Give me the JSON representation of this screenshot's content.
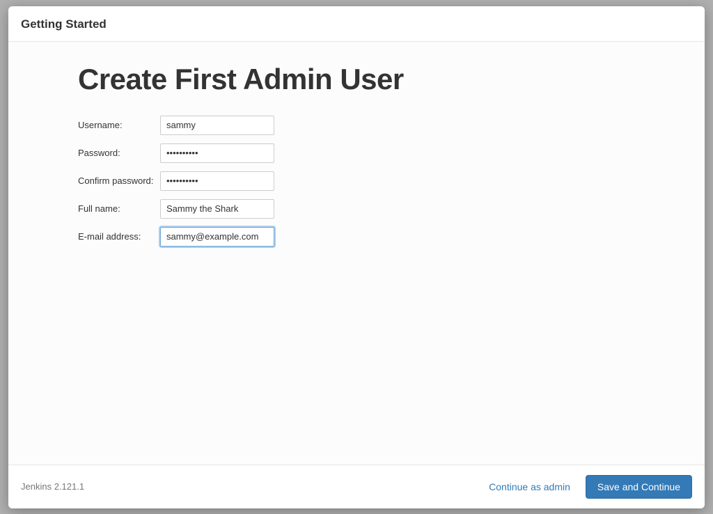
{
  "header": {
    "title": "Getting Started"
  },
  "main": {
    "heading": "Create First Admin User",
    "form": {
      "username": {
        "label": "Username:",
        "value": "sammy"
      },
      "password": {
        "label": "Password:",
        "value": "••••••••••"
      },
      "confirm_password": {
        "label": "Confirm password:",
        "value": "••••••••••"
      },
      "fullname": {
        "label": "Full name:",
        "value": "Sammy the Shark"
      },
      "email": {
        "label": "E-mail address:",
        "value": "sammy@example.com"
      }
    }
  },
  "footer": {
    "version": "Jenkins 2.121.1",
    "continue_as_admin": "Continue as admin",
    "save_and_continue": "Save and Continue"
  }
}
